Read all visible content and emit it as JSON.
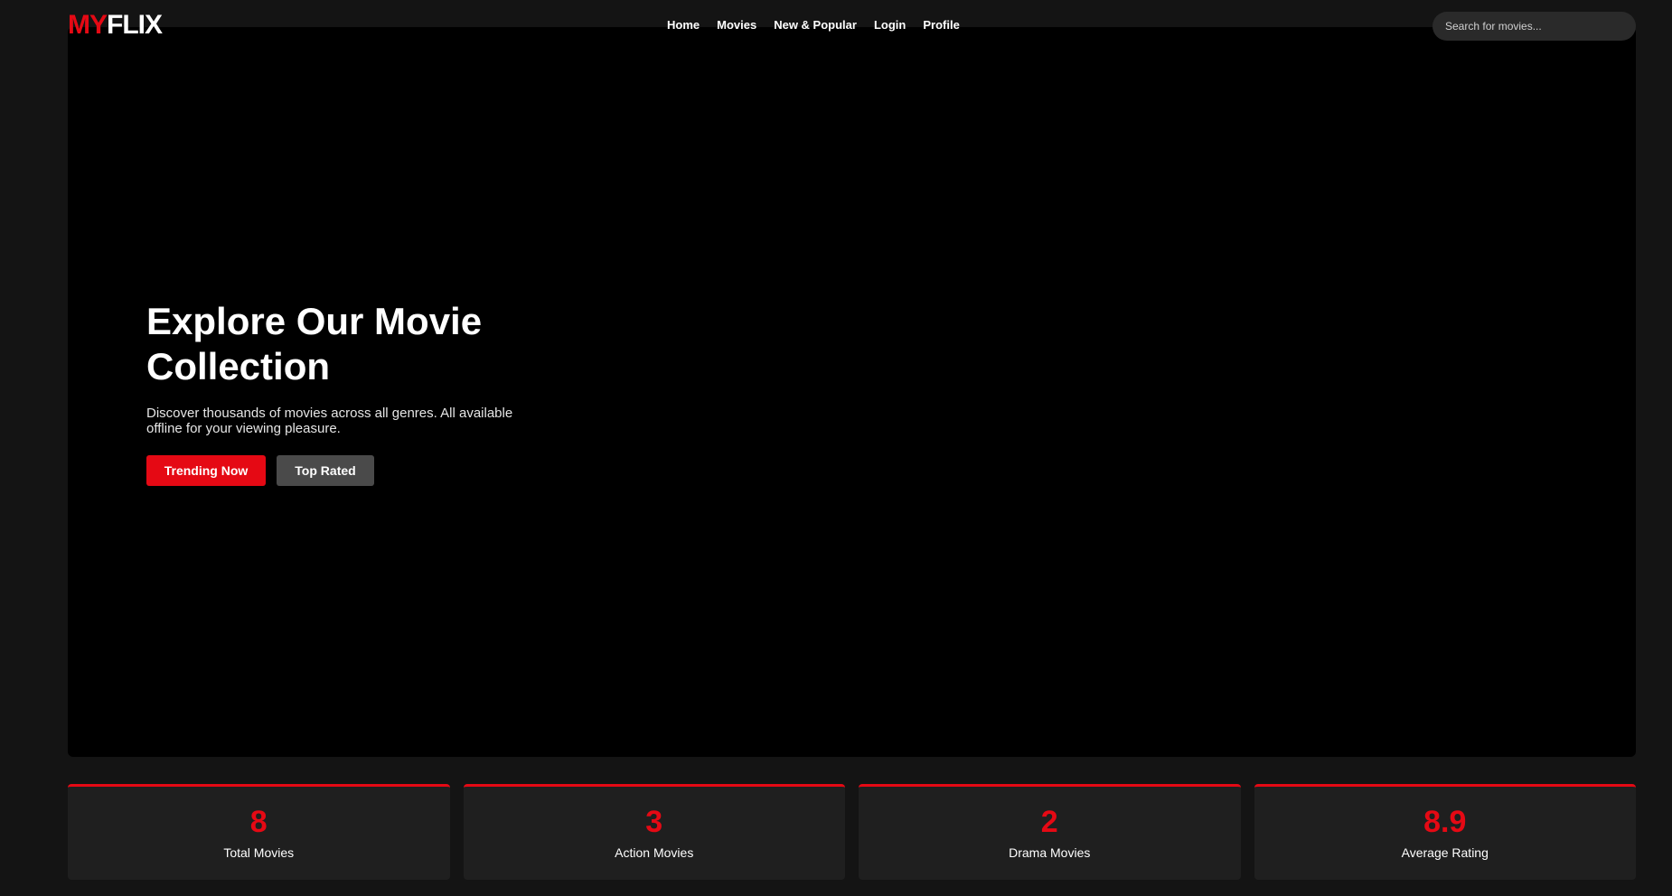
{
  "header": {
    "logo_prefix": "MY",
    "logo_suffix": "FLIX",
    "nav": [
      {
        "label": "Home"
      },
      {
        "label": "Movies"
      },
      {
        "label": "New & Popular"
      },
      {
        "label": "Login"
      },
      {
        "label": "Profile"
      }
    ],
    "search_placeholder": "Search for movies..."
  },
  "hero": {
    "title": "Explore Our Movie Collection",
    "description": "Discover thousands of movies across all genres. All available offline for your viewing pleasure.",
    "primary_button": "Trending Now",
    "secondary_button": "Top Rated"
  },
  "stats": [
    {
      "value": "8",
      "label": "Total Movies"
    },
    {
      "value": "3",
      "label": "Action Movies"
    },
    {
      "value": "2",
      "label": "Drama Movies"
    },
    {
      "value": "8.9",
      "label": "Average Rating"
    }
  ],
  "colors": {
    "accent": "#e50914",
    "background": "#141414",
    "hero_background": "#000000",
    "card_background": "#1f1f1f"
  }
}
